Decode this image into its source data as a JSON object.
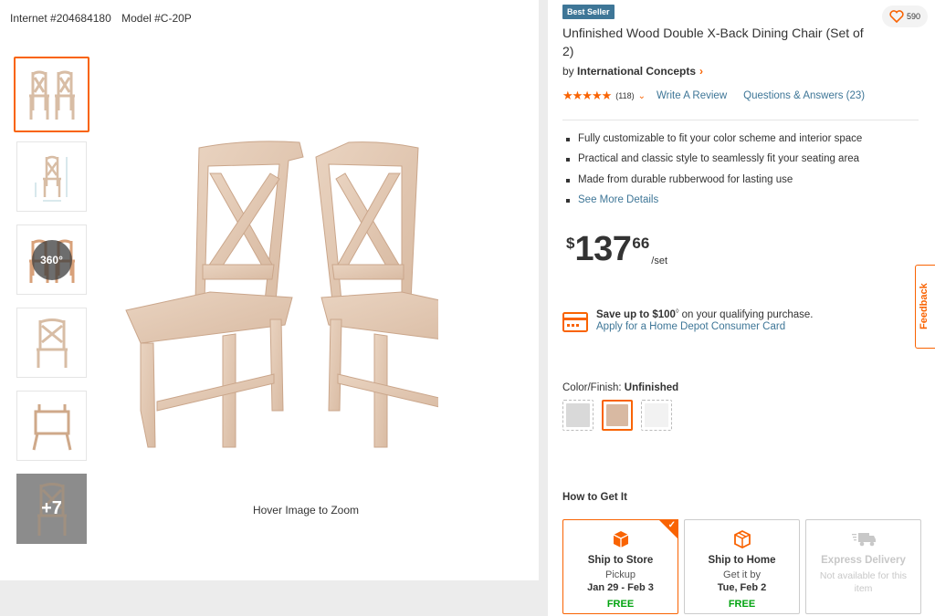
{
  "product_ids": {
    "internet": "Internet #204684180",
    "model": "Model #C-20P"
  },
  "gallery": {
    "thumbnails": [
      {
        "name": "thumb-chairs-pair"
      },
      {
        "name": "thumb-dimensions"
      },
      {
        "name": "thumb-360",
        "badge": "360°"
      },
      {
        "name": "thumb-chair-front"
      },
      {
        "name": "thumb-chair-underside"
      },
      {
        "name": "thumb-more",
        "overlay": "+7"
      }
    ],
    "zoom_hint": "Hover Image to Zoom"
  },
  "product": {
    "badge": "Best Seller",
    "favorites_count": "590",
    "title": "Unfinished Wood Double X-Back Dining Chair (Set of 2)",
    "brand_prefix": "by",
    "brand": "International Concepts",
    "rating_stars": 4.5,
    "rating_count": "(118)",
    "write_review": "Write A Review",
    "qa_link": "Questions & Answers (23)",
    "bullets": [
      "Fully customizable to fit your color scheme and interior space",
      "Practical and classic style to seamlessly fit your seating area",
      "Made from durable rubberwood for lasting use"
    ],
    "see_more": "See More Details"
  },
  "price": {
    "symbol": "$",
    "dollars": "137",
    "cents": "66",
    "unit": "/set"
  },
  "card_offer": {
    "save_prefix": "Save up to",
    "save_amount": "$100",
    "save_sup": "◊",
    "save_suffix": "on your qualifying purchase.",
    "apply_link": "Apply for a Home Depot Consumer Card"
  },
  "color": {
    "label": "Color/Finish:",
    "selected": "Unfinished",
    "swatches": [
      {
        "name": "swatch-gray",
        "color": "#d9d9d9"
      },
      {
        "name": "swatch-unfinished",
        "color": "#d8b9a2"
      },
      {
        "name": "swatch-white",
        "color": "#f2f2f2"
      }
    ]
  },
  "how_to_get": {
    "title": "How to Get It",
    "options": [
      {
        "name": "Ship to Store",
        "line1": "Pickup",
        "line2": "Jan 29 - Feb 3",
        "price": "FREE"
      },
      {
        "name": "Ship to Home",
        "line1": "Get it by",
        "line2": "Tue, Feb 2",
        "price": "FREE"
      },
      {
        "name": "Express Delivery",
        "line1": "Not available for this item"
      }
    ]
  },
  "feedback_tab": "Feedback",
  "colors": {
    "accent": "#f96302",
    "link": "#3e7697",
    "free": "#00a30e",
    "badge": "#3e7697"
  }
}
